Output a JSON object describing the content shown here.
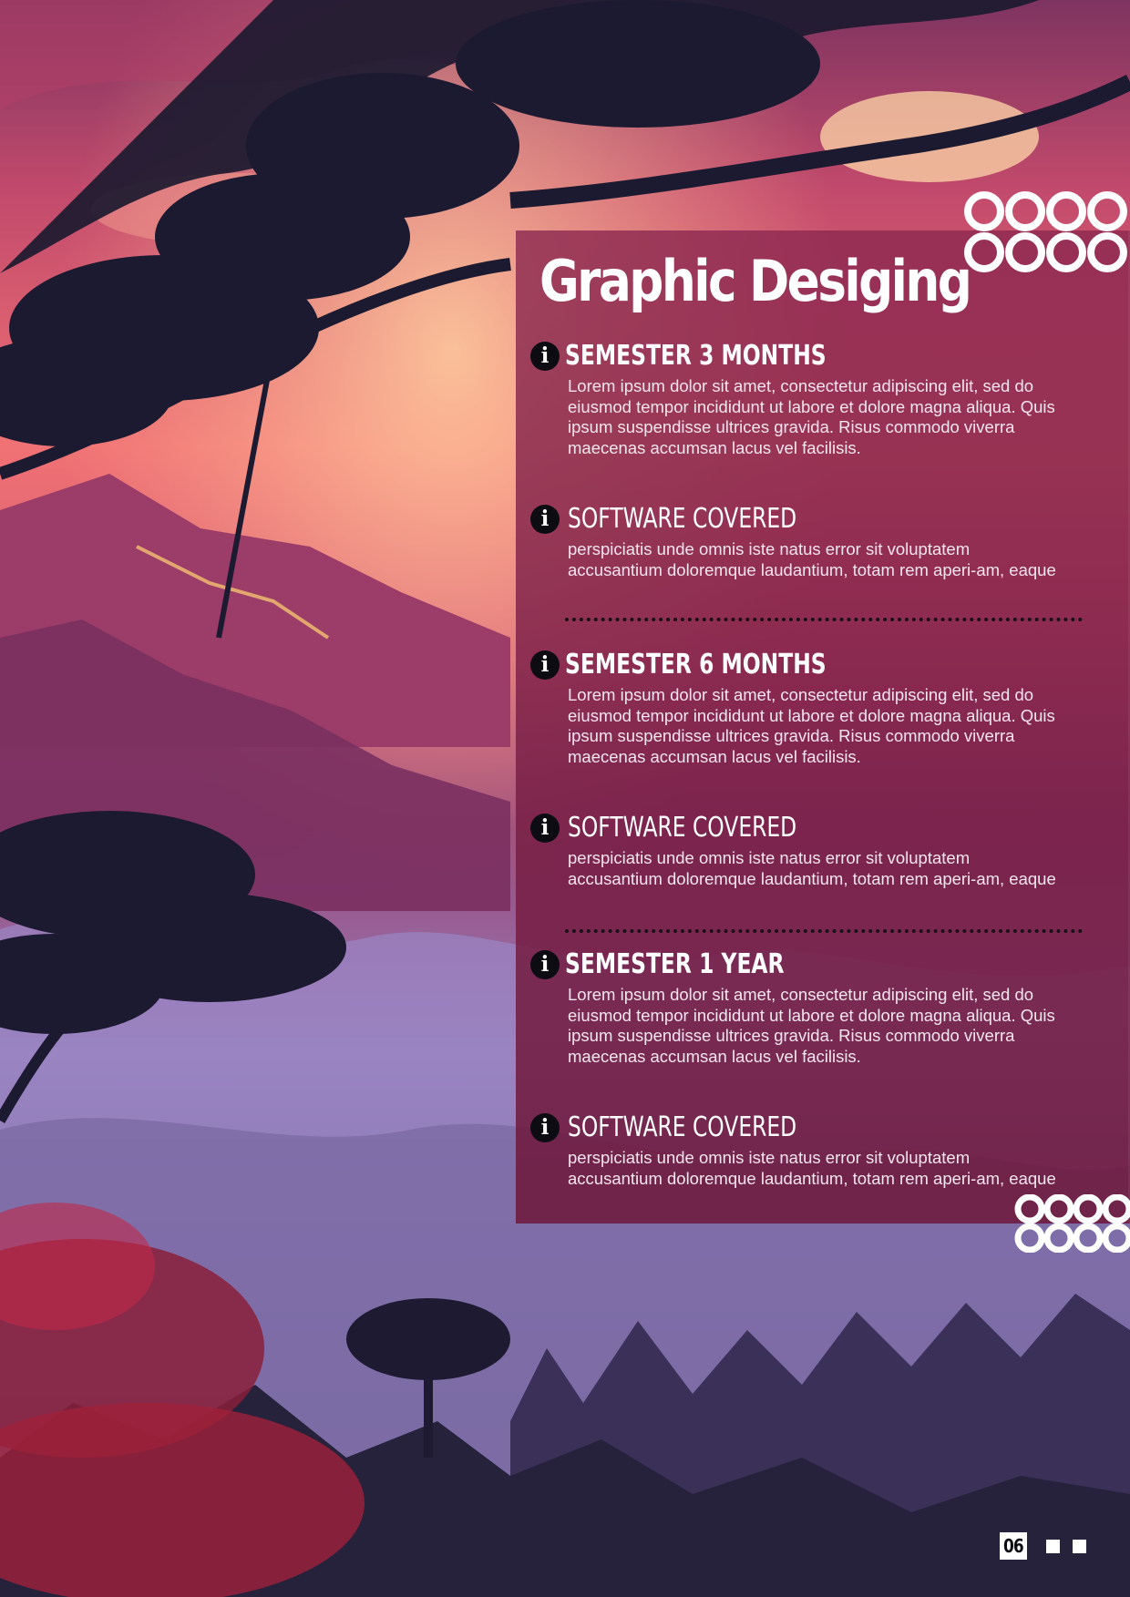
{
  "page": {
    "title": "Graphic Desiging",
    "page_number": "06"
  },
  "sections": [
    {
      "title": "SEMESTER 3 MONTHS",
      "body": "Lorem ipsum dolor sit amet, consectetur adipiscing elit, sed do eiusmod tempor incididunt ut labore et dolore magna aliqua. Quis ipsum suspendisse ultrices gravida. Risus commodo viverra maecenas accumsan lacus vel facilisis.",
      "software_title": "SOFTWARE COVERED",
      "software_body": "perspiciatis unde omnis iste natus error sit voluptatem accusantium doloremque laudantium, totam rem aperi-am, eaque"
    },
    {
      "title": "SEMESTER 6 MONTHS",
      "body": "Lorem ipsum dolor sit amet, consectetur adipiscing elit, sed do eiusmod tempor incididunt ut labore et dolore magna aliqua. Quis ipsum suspendisse ultrices gravida. Risus commodo viverra maecenas accumsan lacus vel facilisis.",
      "software_title": "SOFTWARE COVERED",
      "software_body": "perspiciatis unde omnis iste natus error sit voluptatem accusantium doloremque laudantium, totam rem aperi-am, eaque"
    },
    {
      "title": "SEMESTER 1 YEAR",
      "body": "Lorem ipsum dolor sit amet, consectetur adipiscing elit, sed do eiusmod tempor incididunt ut labore et dolore magna aliqua. Quis ipsum suspendisse ultrices gravida. Risus commodo viverra maecenas accumsan lacus vel facilisis.",
      "software_title": "SOFTWARE COVERED",
      "software_body": "perspiciatis unde omnis iste natus error sit voluptatem accusantium doloremque laudantium, totam rem aperi-am, eaque"
    }
  ],
  "icons": {
    "info": "i",
    "section_icon_name": "info-icon",
    "decor_name": "ring-pattern-icon"
  },
  "colors": {
    "panel": "#8c2850",
    "text": "#ffffff",
    "body_text": "#f4e6ee",
    "icon_bg": "#0c0c12",
    "sky_pink": "#f0707a",
    "sky_dusk": "#7a3a6a",
    "mist_lavender": "#a48ac4",
    "tree_silhouette": "#1c1a30"
  }
}
